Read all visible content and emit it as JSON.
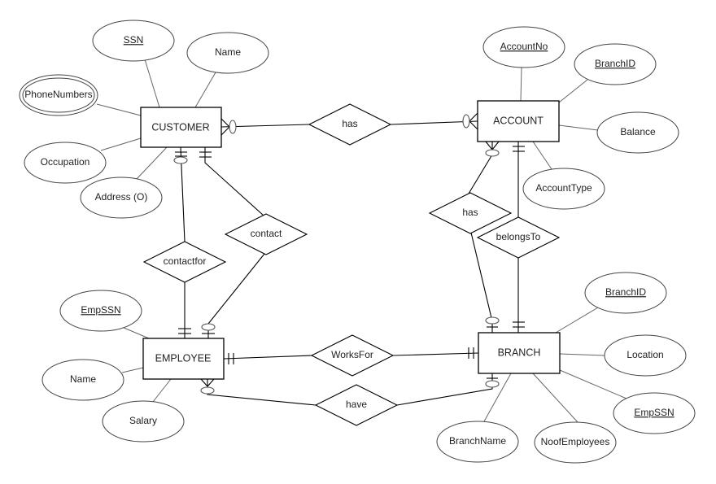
{
  "entities": {
    "customer": "CUSTOMER",
    "account": "ACCOUNT",
    "employee": "EMPLOYEE",
    "branch": "BRANCH"
  },
  "relationships": {
    "has_customer_account": "has",
    "has_account_branch": "has",
    "belongs_to": "belongsTo",
    "contact": "contact",
    "contactfor": "contactfor",
    "works_for": "WorksFor",
    "have": "have"
  },
  "attributes": {
    "customer": {
      "ssn": "SSN",
      "name": "Name",
      "phone_numbers": "PhoneNumbers",
      "occupation": "Occupation",
      "address": "Address (O)"
    },
    "account": {
      "account_no": "AccountNo",
      "branch_id": "BranchID",
      "balance": "Balance",
      "account_type": "AccountType"
    },
    "branch": {
      "branch_id": "BranchID",
      "location": "Location",
      "emp_ssn": "EmpSSN",
      "noof_employees": "NoofEmployees",
      "branch_name": "BranchName"
    },
    "employee": {
      "emp_ssn": "EmpSSN",
      "name": "Name",
      "salary": "Salary"
    }
  }
}
